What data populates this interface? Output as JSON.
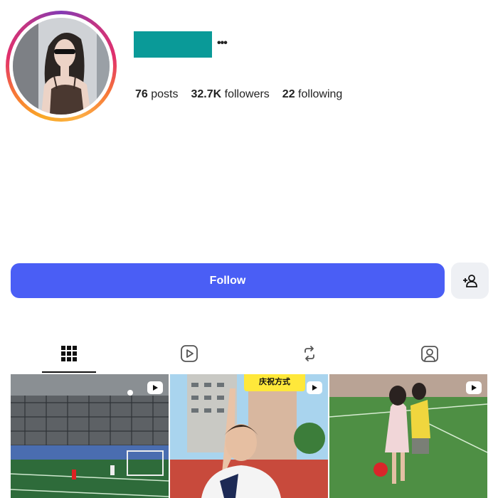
{
  "profile": {
    "stats": [
      {
        "value": "76",
        "label": "posts"
      },
      {
        "value": "32.7K",
        "label": "followers"
      },
      {
        "value": "22",
        "label": "following"
      }
    ]
  },
  "actions": {
    "follow_label": "Follow"
  },
  "tabs": [
    {
      "icon": "grid-icon",
      "active": true
    },
    {
      "icon": "reels-icon",
      "active": false
    },
    {
      "icon": "reposts-icon",
      "active": false
    },
    {
      "icon": "tagged-icon",
      "active": false
    }
  ],
  "posts": [
    {
      "type": "reel",
      "scene": "indoor-football-court"
    },
    {
      "type": "reel",
      "scene": "player-pointing-up",
      "caption": "庆祝方式"
    },
    {
      "type": "reel",
      "scene": "children-playing-football"
    }
  ],
  "colors": {
    "accent": "#4a5ef5",
    "username_block": "#0a9a98"
  }
}
